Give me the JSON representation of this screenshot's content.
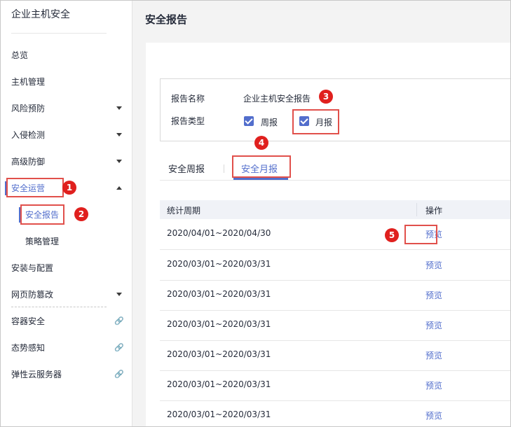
{
  "sidebar": {
    "brand": "企业主机安全",
    "items": [
      {
        "label": "总览"
      },
      {
        "label": "主机管理"
      },
      {
        "label": "风险预防"
      },
      {
        "label": "入侵检测"
      },
      {
        "label": "高级防御"
      },
      {
        "label": "安全运营"
      },
      {
        "label": "安装与配置"
      },
      {
        "label": "网页防篡改"
      },
      {
        "label": "容器安全"
      },
      {
        "label": "态势感知"
      },
      {
        "label": "弹性云服务器"
      }
    ],
    "subitems": [
      {
        "label": "安全报告"
      },
      {
        "label": "策略管理"
      }
    ]
  },
  "main": {
    "title": "安全报告",
    "info": {
      "name_label": "报告名称",
      "name_value": "企业主机安全报告",
      "type_label": "报告类型",
      "type_weekly": "周报",
      "type_monthly": "月报"
    },
    "tabs": [
      {
        "label": "安全周报"
      },
      {
        "label": "安全月报"
      }
    ],
    "table": {
      "columns": [
        "统计周期",
        "操作"
      ],
      "rows": [
        {
          "period": "2020/04/01~2020/04/30",
          "action": "预览"
        },
        {
          "period": "2020/03/01~2020/03/31",
          "action": "预览"
        },
        {
          "period": "2020/03/01~2020/03/31",
          "action": "预览"
        },
        {
          "period": "2020/03/01~2020/03/31",
          "action": "预览"
        },
        {
          "period": "2020/03/01~2020/03/31",
          "action": "预览"
        },
        {
          "period": "2020/03/01~2020/03/31",
          "action": "预览"
        },
        {
          "period": "2020/03/01~2020/03/31",
          "action": "预览"
        }
      ]
    }
  },
  "callouts": [
    "1",
    "2",
    "3",
    "4",
    "5"
  ],
  "colors": {
    "accent": "#526ecc",
    "highlight": "#e1504b",
    "badge": "#e0201e"
  }
}
